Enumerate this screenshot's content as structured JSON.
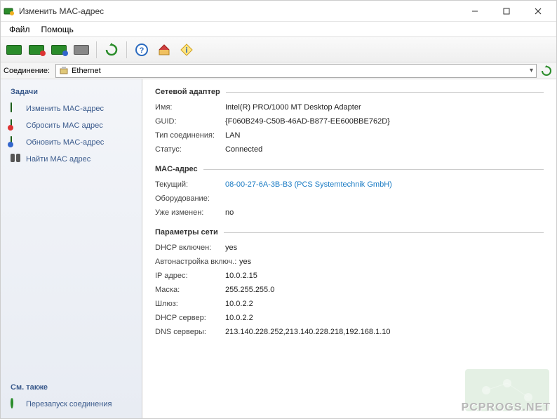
{
  "window": {
    "title": "Изменить MAC-адрес"
  },
  "menu": {
    "file": "Файл",
    "help": "Помощь"
  },
  "connection_bar": {
    "label": "Соединение:",
    "selected": "Ethernet"
  },
  "sidebar": {
    "tasks_title": "Задачи",
    "items": [
      {
        "label": "Изменить MAC-адрес"
      },
      {
        "label": "Сбросить MAC адрес"
      },
      {
        "label": "Обновить MAC-адрес"
      },
      {
        "label": "Найти MAC адрес"
      }
    ],
    "see_also_title": "См. также",
    "see_also": [
      {
        "label": "Перезапуск соединения"
      }
    ]
  },
  "sections": {
    "adapter": {
      "title": "Сетевой адаптер",
      "rows": {
        "name_label": "Имя:",
        "name_value": "Intel(R) PRO/1000 MT Desktop Adapter",
        "guid_label": "GUID:",
        "guid_value": "{F060B249-C50B-46AD-B877-EE600BBE762D}",
        "type_label": "Тип соединения:",
        "type_value": "LAN",
        "status_label": "Статус:",
        "status_value": "Connected"
      }
    },
    "mac": {
      "title": "MAC-адрес",
      "rows": {
        "current_label": "Текущий:",
        "current_value": "08-00-27-6A-3B-B3 (PCS Systemtechnik GmbH)",
        "hw_label": "Оборудование:",
        "hw_value": "",
        "changed_label": "Уже изменен:",
        "changed_value": "no"
      }
    },
    "net": {
      "title": "Параметры сети",
      "rows": {
        "dhcp_label": "DHCP включен:",
        "dhcp_value": "yes",
        "auto_label": "Автонастройка включ.:",
        "auto_value": "yes",
        "ip_label": "IP адрес:",
        "ip_value": "10.0.2.15",
        "mask_label": "Маска:",
        "mask_value": "255.255.255.0",
        "gw_label": "Шлюз:",
        "gw_value": "10.0.2.2",
        "dhcps_label": "DHCP сервер:",
        "dhcps_value": "10.0.2.2",
        "dns_label": "DNS серверы:",
        "dns_value": "213.140.228.252,213.140.228.218,192.168.1.10"
      }
    }
  },
  "watermark": "PCPROGS.NET"
}
